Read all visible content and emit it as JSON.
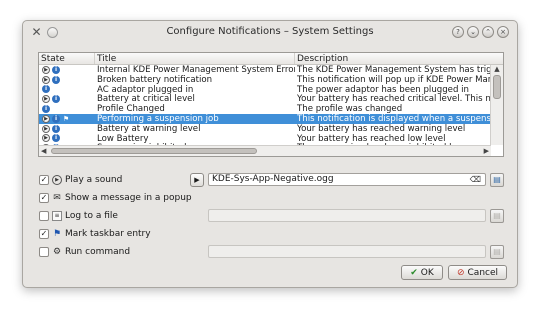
{
  "window": {
    "title": "Configure Notifications – System Settings",
    "app_icon": "tools-icon",
    "controls": [
      "help-icon",
      "minimize-icon",
      "maximize-icon",
      "close-icon"
    ]
  },
  "table": {
    "headers": {
      "state": "State",
      "title": "Title",
      "description": "Description"
    },
    "rows": [
      {
        "title": "Internal KDE Power Management System Error",
        "description": "The KDE Power Management System has trigge",
        "state": [
          "play",
          "info"
        ],
        "selected": false
      },
      {
        "title": "Broken battery notification",
        "description": "This notification will pop up if KDE Power Manage",
        "state": [
          "play",
          "info"
        ],
        "selected": false
      },
      {
        "title": "AC adaptor plugged in",
        "description": "The power adaptor has been plugged in",
        "state": [
          "info"
        ],
        "selected": false
      },
      {
        "title": "Battery at critical level",
        "description": "Your battery has reached critical level. This notifi",
        "state": [
          "play",
          "info"
        ],
        "selected": false
      },
      {
        "title": "Profile Changed",
        "description": "The profile was changed",
        "state": [
          "info"
        ],
        "selected": false
      },
      {
        "title": "Performing a suspension job",
        "description": "This notification is displayed when a suspension",
        "state": [
          "play",
          "info",
          "flag"
        ],
        "selected": true
      },
      {
        "title": "Battery at warning level",
        "description": "Your battery has reached warning level",
        "state": [
          "play",
          "info"
        ],
        "selected": false
      },
      {
        "title": "Low Battery",
        "description": "Your battery has reached low level",
        "state": [
          "play",
          "info"
        ],
        "selected": false
      },
      {
        "title": "Suspension inhibited",
        "description": "The suspension has been inhibited because an",
        "state": [
          "play",
          "info"
        ],
        "selected": false
      }
    ]
  },
  "options": {
    "play_sound": {
      "label": "Play a sound",
      "checked": true,
      "value": "KDE-Sys-App-Negative.ogg"
    },
    "show_popup": {
      "label": "Show a message in a popup",
      "checked": true
    },
    "log_file": {
      "label": "Log to a file",
      "checked": false,
      "value": ""
    },
    "taskbar": {
      "label": "Mark taskbar entry",
      "checked": true
    },
    "run_command": {
      "label": "Run command",
      "checked": false,
      "value": ""
    }
  },
  "buttons": {
    "ok": "OK",
    "cancel": "Cancel"
  },
  "colors": {
    "selection": "#3f8fd8",
    "window_bg": "#e7e5e2",
    "info_icon": "#2f6fbe"
  }
}
